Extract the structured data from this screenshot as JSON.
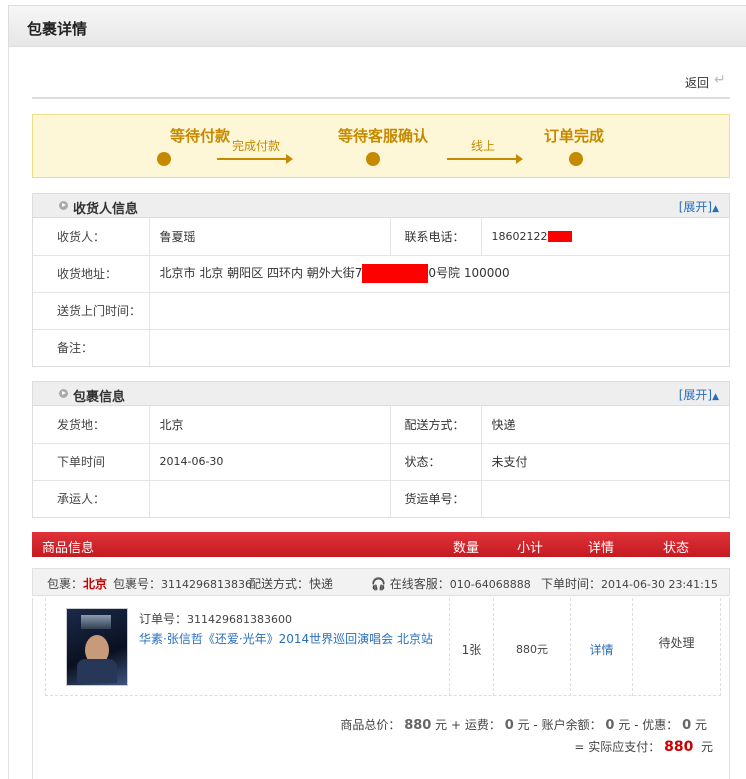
{
  "header": {
    "title": "包裹详情"
  },
  "toolbar": {
    "back_label": "返回"
  },
  "steps": {
    "s1": "等待付款",
    "s2": "等待客服确认",
    "s3": "订单完成",
    "a1": "完成付款",
    "a2": "线上",
    "color": "#c58a00"
  },
  "receiver": {
    "section_title": "收货人信息",
    "expand": "[展开]",
    "name_label": "收货人：",
    "name": "鲁夏瑶",
    "phone_label": "联系电话：",
    "phone": "18602122",
    "address_label": "收货地址：",
    "address_a": "北京市 北京 朝阳区 四环内 朝外大街7",
    "address_b": "0号院 100000",
    "time_label": "送货上门时间：",
    "time": "",
    "note_label": "备注：",
    "note": ""
  },
  "package": {
    "section_title": "包裹信息",
    "expand": "[展开]",
    "from_label": "发货地：",
    "from": "北京",
    "ship_label": "配送方式：",
    "ship": "快递",
    "order_time_label": "下单时间",
    "order_time": "2014-06-30",
    "status_label": "状态：",
    "status": "未支付",
    "carrier_label": "承运人：",
    "carrier": "",
    "tracking_label": "货运单号：",
    "tracking": ""
  },
  "goods": {
    "headers": {
      "info": "商品信息",
      "qty": "数量",
      "subtotal": "小计",
      "detail": "详情",
      "status": "状态"
    },
    "pkg": {
      "label": "包裹：",
      "city": "北京",
      "no_label": "包裹号：",
      "no": "3114296813836",
      "ship_label": "配送方式：",
      "ship": "快递",
      "cs_label": "在线客服：",
      "cs": "010-64068888",
      "time_label": "下单时间：",
      "time": "2014-06-30 23:41:15"
    },
    "item": {
      "order_label": "订单号：",
      "order_no": "311429681383600",
      "name": "华素·张信哲《还爱·光年》2014世界巡回演唱会 北京站",
      "qty": "1张",
      "subtotal": "880元",
      "detail": "详情",
      "status": "待处理"
    }
  },
  "totals": {
    "goods_label": "商品总价：",
    "goods": "880",
    "unit": "元",
    "plus": "+ 运费：",
    "freight": "0",
    "minus1": "- 账户余额：",
    "balance": "0",
    "minus2": "- 优惠：",
    "discount": "0",
    "pay_label": "= 实际应支付：",
    "pay": "880"
  },
  "colors": {
    "accent_red": "#c41a20",
    "link_blue": "#2a6ebb",
    "step_gold": "#c58a00"
  }
}
